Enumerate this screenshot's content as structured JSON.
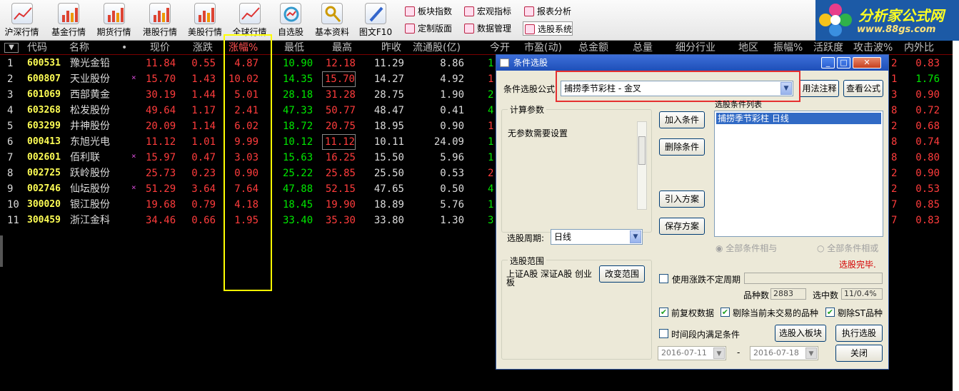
{
  "toolbar": {
    "items": [
      {
        "label": "沪深行情",
        "icon": "line-chart-icon"
      },
      {
        "label": "基金行情",
        "icon": "bar-chart-icon"
      },
      {
        "label": "期货行情",
        "icon": "bar-chart-icon"
      },
      {
        "label": "港股行情",
        "icon": "bar-chart-icon"
      },
      {
        "label": "美股行情",
        "icon": "bar-chart-icon"
      },
      {
        "label": "全球行情",
        "icon": "line-chart-icon"
      },
      {
        "label": "自选股",
        "icon": "stock-select-icon"
      },
      {
        "label": "基本资料",
        "icon": "key-icon"
      },
      {
        "label": "图文F10",
        "icon": "pen-icon"
      }
    ],
    "mini": [
      {
        "label": "板块指数"
      },
      {
        "label": "宏观指标"
      },
      {
        "label": "报表分析"
      },
      {
        "label": "定制版面"
      },
      {
        "label": "数据管理"
      },
      {
        "label": "选股系统"
      }
    ],
    "logo_title": "分析家公式网",
    "logo_url": "www.88gs.com"
  },
  "table": {
    "headers": [
      "代码",
      "名称",
      "现价",
      "涨跌",
      "涨幅%",
      "最低",
      "最高",
      "昨收",
      "流通股(亿)",
      "今开",
      "市盈(动)",
      "总金额",
      "总量",
      "细分行业",
      "地区",
      "振幅%",
      "活跃度",
      "攻击波%",
      "内外比"
    ],
    "sort_icon": "▼",
    "rows": [
      {
        "idx": "1",
        "code": "600531",
        "name": "豫光金铅",
        "mark": "",
        "price": "11.84",
        "chg": "0.55",
        "pct": "4.87",
        "low": "10.90",
        "high": "12.18",
        "prev": "11.29",
        "float": "8.86",
        "open": "1",
        "r1": "2",
        "r2": "0.83"
      },
      {
        "idx": "2",
        "code": "600807",
        "name": "天业股份",
        "mark": "×",
        "price": "15.70",
        "chg": "1.43",
        "pct": "10.02",
        "low": "14.35",
        "high": "15.70",
        "prev": "14.27",
        "float": "4.92",
        "open": "1",
        "r1": "1",
        "r2": "1.76"
      },
      {
        "idx": "3",
        "code": "601069",
        "name": "西部黄金",
        "mark": "",
        "price": "30.19",
        "chg": "1.44",
        "pct": "5.01",
        "low": "28.18",
        "high": "31.28",
        "prev": "28.75",
        "float": "1.90",
        "open": "2",
        "r1": "3",
        "r2": "0.90"
      },
      {
        "idx": "4",
        "code": "603268",
        "name": "松发股份",
        "mark": "",
        "price": "49.64",
        "chg": "1.17",
        "pct": "2.41",
        "low": "47.33",
        "high": "50.77",
        "prev": "48.47",
        "float": "0.41",
        "open": "4",
        "r1": "8",
        "r2": "0.72"
      },
      {
        "idx": "5",
        "code": "603299",
        "name": "井神股份",
        "mark": "",
        "price": "20.09",
        "chg": "1.14",
        "pct": "6.02",
        "low": "18.72",
        "high": "20.75",
        "prev": "18.95",
        "float": "0.90",
        "open": "1",
        "r1": "2",
        "r2": "0.68"
      },
      {
        "idx": "6",
        "code": "000413",
        "name": "东旭光电",
        "mark": "",
        "price": "11.12",
        "chg": "1.01",
        "pct": "9.99",
        "low": "10.12",
        "high": "11.12",
        "prev": "10.11",
        "float": "24.09",
        "open": "1",
        "r1": "8",
        "r2": "0.74"
      },
      {
        "idx": "7",
        "code": "002601",
        "name": "佰利联",
        "mark": "×",
        "price": "15.97",
        "chg": "0.47",
        "pct": "3.03",
        "low": "15.63",
        "high": "16.25",
        "prev": "15.50",
        "float": "5.96",
        "open": "1",
        "r1": "8",
        "r2": "0.80"
      },
      {
        "idx": "8",
        "code": "002725",
        "name": "跃岭股份",
        "mark": "",
        "price": "25.73",
        "chg": "0.23",
        "pct": "0.90",
        "low": "25.22",
        "high": "25.85",
        "prev": "25.50",
        "float": "0.53",
        "open": "2",
        "r1": "2",
        "r2": "0.90"
      },
      {
        "idx": "9",
        "code": "002746",
        "name": "仙坛股份",
        "mark": "×",
        "price": "51.29",
        "chg": "3.64",
        "pct": "7.64",
        "low": "47.88",
        "high": "52.15",
        "prev": "47.65",
        "float": "0.50",
        "open": "4",
        "r1": "2",
        "r2": "0.53"
      },
      {
        "idx": "10",
        "code": "300020",
        "name": "银江股份",
        "mark": "",
        "price": "19.68",
        "chg": "0.79",
        "pct": "4.18",
        "low": "18.45",
        "high": "19.90",
        "prev": "18.89",
        "float": "5.76",
        "open": "1",
        "r1": "7",
        "r2": "0.85"
      },
      {
        "idx": "11",
        "code": "300459",
        "name": "浙江金科",
        "mark": "",
        "price": "34.46",
        "chg": "0.66",
        "pct": "1.95",
        "low": "33.40",
        "high": "35.30",
        "prev": "33.80",
        "float": "1.30",
        "open": "3",
        "r1": "7",
        "r2": "0.83"
      }
    ]
  },
  "dialog": {
    "title": "条件选股",
    "formula_label": "条件选股公式",
    "formula_value": "捕捞季节彩柱 - 金叉",
    "usage_btn": "用法注释",
    "view_btn": "查看公式",
    "params_group": "计算参数",
    "params_text": "无参数需要设置",
    "list_label": "选股条件列表",
    "list_items": [
      "捕捞季节彩柱  日线"
    ],
    "add_btn": "加入条件",
    "del_btn": "删除条件",
    "import_btn": "引入方案",
    "save_btn": "保存方案",
    "period_label": "选股周期:",
    "period_value": "日线",
    "radio_and": "全部条件相与",
    "radio_or": "全部条件相或",
    "status": "选股完毕.",
    "range_group": "选股范围",
    "range_text": "上证A股 深证A股 创业板",
    "change_range_btn": "改变范围",
    "use_variable": "使用涨跌不定周期",
    "count_label": "品种数",
    "count_value": "2883",
    "selected_label": "选中数",
    "selected_value": "11/0.4%",
    "fq_label": "前复权数据",
    "exclude_untraded": "剔除当前未交易的品种",
    "exclude_st": "剔除ST品种",
    "period_cond": "时间段内满足条件",
    "to_block_btn": "选股入板块",
    "run_btn": "执行选股",
    "date_from": "2016-07-11",
    "date_sep": "-",
    "date_to": "2016-07-18",
    "close_btn": "关闭"
  }
}
